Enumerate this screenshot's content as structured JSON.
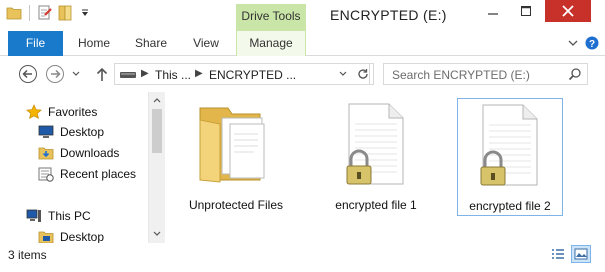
{
  "window": {
    "title": "ENCRYPTED (E:)",
    "contextual_group": "Drive Tools",
    "controls": {
      "minimize": "minimize",
      "maximize": "maximize",
      "close": "close"
    }
  },
  "quick_access_toolbar": {
    "icons": [
      "folder-icon",
      "properties-icon",
      "new-folder-icon",
      "customize-dropdown-icon"
    ]
  },
  "ribbon": {
    "tabs": [
      {
        "label": "File",
        "active": true
      },
      {
        "label": "Home"
      },
      {
        "label": "Share"
      },
      {
        "label": "View"
      },
      {
        "label": "Manage",
        "contextual": true
      }
    ]
  },
  "address_bar": {
    "breadcrumb": [
      "This ...",
      "ENCRYPTED ..."
    ],
    "search_placeholder": "Search ENCRYPTED (E:)"
  },
  "navigation_pane": {
    "items": [
      {
        "label": "Favorites",
        "icon": "star-icon",
        "level": 0
      },
      {
        "label": "Desktop",
        "icon": "desktop-icon",
        "level": 1
      },
      {
        "label": "Downloads",
        "icon": "downloads-folder-icon",
        "level": 1
      },
      {
        "label": "Recent places",
        "icon": "recent-places-icon",
        "level": 1
      },
      {
        "label": "This PC",
        "icon": "computer-icon",
        "level": 0
      },
      {
        "label": "Desktop",
        "icon": "folder-icon",
        "level": 1
      }
    ]
  },
  "files": [
    {
      "name": "Unprotected Files",
      "type": "folder",
      "icon": "folder-icon"
    },
    {
      "name": "encrypted file 1",
      "type": "encrypted-file",
      "icon": "locked-file-icon"
    },
    {
      "name": "encrypted file 2",
      "type": "encrypted-file",
      "icon": "locked-file-icon",
      "selected": true
    }
  ],
  "status_bar": {
    "item_count": "3 items"
  },
  "colors": {
    "file_tab": "#1979ca",
    "close_button": "#c7312a",
    "contextual_tab": "#c9e6a8",
    "selection_border": "#7eb4ea"
  }
}
